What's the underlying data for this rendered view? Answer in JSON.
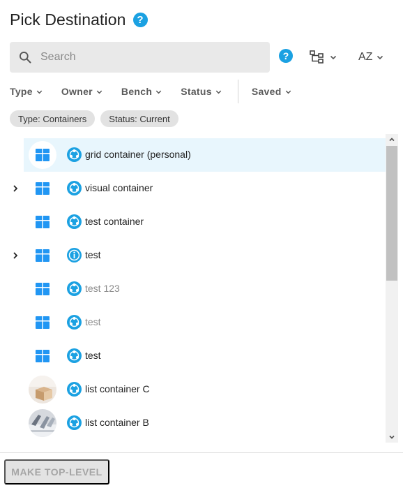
{
  "header": {
    "title": "Pick Destination",
    "help_icon": "help-circle-icon"
  },
  "search": {
    "placeholder": "Search",
    "value": "",
    "help_icon": "help-circle-icon"
  },
  "toolbar": {
    "view_icon": "tree-view-icon",
    "sort_label": "AZ"
  },
  "filters": [
    {
      "label": "Type"
    },
    {
      "label": "Owner"
    },
    {
      "label": "Bench"
    },
    {
      "label": "Status"
    },
    {
      "label": "Saved"
    }
  ],
  "chips": [
    {
      "label": "Type: Containers"
    },
    {
      "label": "Status: Current"
    }
  ],
  "items": [
    {
      "name": "grid container (personal)",
      "thumb": "container-icon",
      "status": "shared-icon",
      "expandable": false,
      "selected": true,
      "dim": false
    },
    {
      "name": "visual container",
      "thumb": "container-icon",
      "status": "shared-icon",
      "expandable": true,
      "selected": false,
      "dim": false
    },
    {
      "name": "test container",
      "thumb": "container-icon",
      "status": "shared-icon",
      "expandable": false,
      "selected": false,
      "dim": false
    },
    {
      "name": "test",
      "thumb": "container-icon",
      "status": "info-icon",
      "expandable": true,
      "selected": false,
      "dim": false
    },
    {
      "name": "test 123",
      "thumb": "container-icon",
      "status": "shared-icon",
      "expandable": false,
      "selected": false,
      "dim": true
    },
    {
      "name": "test",
      "thumb": "container-icon",
      "status": "shared-icon",
      "expandable": false,
      "selected": false,
      "dim": true
    },
    {
      "name": "test",
      "thumb": "container-icon",
      "status": "shared-icon",
      "expandable": false,
      "selected": false,
      "dim": false
    },
    {
      "name": "list container C",
      "thumb": "photo-thumbnail",
      "status": "shared-icon",
      "expandable": false,
      "selected": false,
      "dim": false
    },
    {
      "name": "list container B",
      "thumb": "photo-thumbnail",
      "status": "shared-icon",
      "expandable": false,
      "selected": false,
      "dim": false
    }
  ],
  "footer": {
    "make_top_level_label": "MAKE TOP-LEVEL"
  },
  "colors": {
    "accent": "#1ba1e2",
    "container_blue": "#2196f3",
    "selected_row": "#e8f6fd"
  }
}
